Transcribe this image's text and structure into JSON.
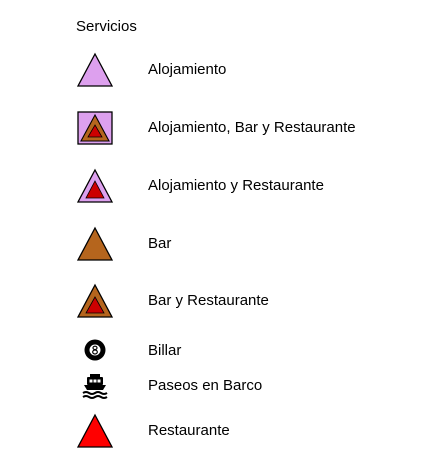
{
  "legend": {
    "title": "Servicios",
    "colors": {
      "alojamiento_fill": "#dda0ee",
      "bar_fill": "#b5651d",
      "restaurante_fill": "#ff0000",
      "inner_red": "#cc0000",
      "outline": "#000000"
    },
    "items": [
      {
        "label": "Alojamiento",
        "icon": "lilac-triangle-icon"
      },
      {
        "label": "Alojamiento, Bar y Restaurante",
        "icon": "lilac-square-brown-red-triangle-icon"
      },
      {
        "label": "Alojamiento y Restaurante",
        "icon": "lilac-triangle-red-inner-icon"
      },
      {
        "label": "Bar",
        "icon": "brown-triangle-icon"
      },
      {
        "label": "Bar y Restaurante",
        "icon": "brown-triangle-red-inner-icon"
      },
      {
        "label": "Billar",
        "icon": "billiard-eight-ball-icon"
      },
      {
        "label": "Paseos en Barco",
        "icon": "boat-icon"
      },
      {
        "label": "Restaurante",
        "icon": "red-triangle-icon"
      }
    ]
  }
}
